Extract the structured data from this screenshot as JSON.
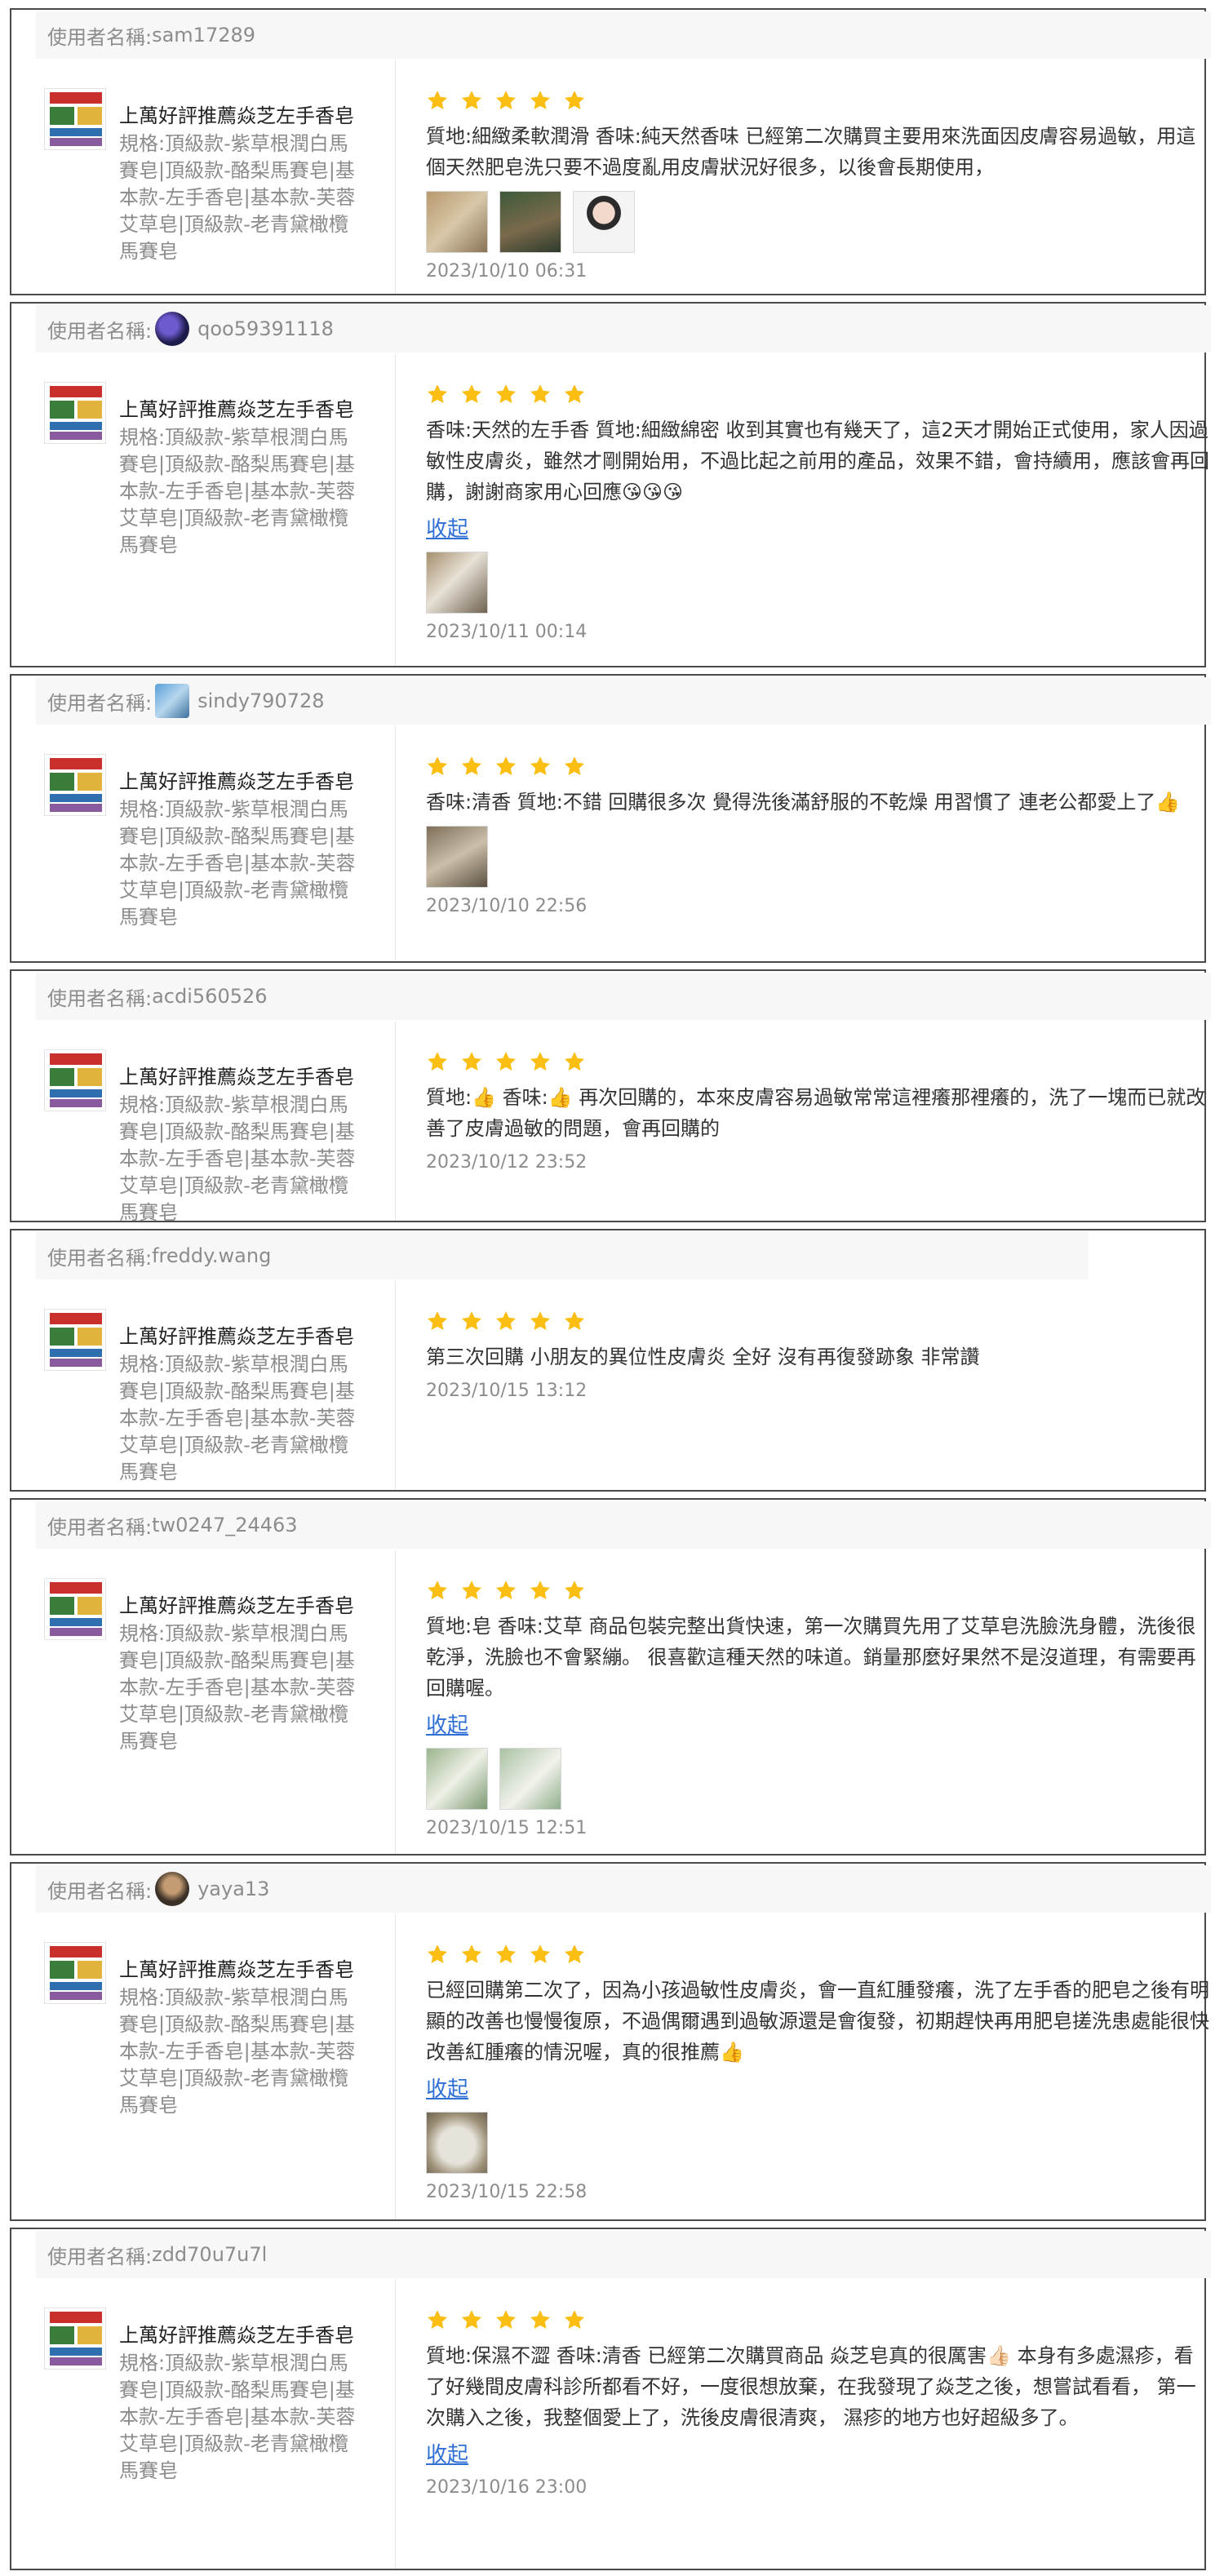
{
  "labels": {
    "username_prefix": "使用者名稱:",
    "collapse": "收起"
  },
  "product": {
    "name": "上萬好評推薦焱芝左手香皂",
    "spec": "規格:頂級款-紫草根潤白馬賽皂|頂級款-酪梨馬賽皂|基本款-左手香皂|基本款-芙蓉艾草皂|頂級款-老青黛橄欖馬賽皂"
  },
  "colors": {
    "star": "#fbbf14",
    "link": "#2f6fd6",
    "border": "#4a4a4a",
    "header_bg": "#f7f7f7"
  },
  "reviews": [
    {
      "username": "sam17289",
      "rating": 5,
      "text": "質地:細緻柔軟潤滑 香味:純天然香味 已經第二次購買主要用來洗面因皮膚容易過敏，用這個天然肥皂洗只要不過度亂用皮膚狀況好很多，以後會長期使用，",
      "photos": 3,
      "date": "2023/10/10 06:31"
    },
    {
      "username": "qoo59391118",
      "rating": 5,
      "text": "香味:天然的左手香 質地:細緻綿密 收到其實也有幾天了，這2天才開始正式使用，家人因過敏性皮膚炎，雖然才剛開始用，不過比起之前用的產品，效果不錯，會持續用，應該會再回購，謝謝商家用心回應😘😘😘",
      "photos": 1,
      "date": "2023/10/11 00:14"
    },
    {
      "username": "sindy790728",
      "rating": 5,
      "text": "香味:清香 質地:不錯 回購很多次 覺得洗後滿舒服的不乾燥 用習慣了 連老公都愛上了👍",
      "photos": 1,
      "date": "2023/10/10 22:56"
    },
    {
      "username": "acdi560526",
      "rating": 5,
      "text": "質地:👍 香味:👍 再次回購的，本來皮膚容易過敏常常這裡癢那裡癢的，洗了一塊而已就改善了皮膚過敏的問題，會再回購的",
      "photos": 0,
      "date": "2023/10/12 23:52"
    },
    {
      "username": "freddy.wang",
      "rating": 5,
      "text": "第三次回購 小朋友的異位性皮膚炎 全好 沒有再復發跡象 非常讚",
      "photos": 0,
      "date": "2023/10/15 13:12"
    },
    {
      "username": "tw0247_24463",
      "rating": 5,
      "text": "質地:皂 香味:艾草 商品包裝完整出貨快速，第一次購買先用了艾草皂洗臉洗身體，洗後很乾淨，洗臉也不會緊繃。 很喜歡這種天然的味道。銷量那麼好果然不是沒道理，有需要再回購喔。",
      "photos": 2,
      "date": "2023/10/15 12:51"
    },
    {
      "username": "yaya13",
      "rating": 5,
      "text": "已經回購第二次了，因為小孩過敏性皮膚炎，會一直紅腫發癢，洗了左手香的肥皂之後有明顯的改善也慢慢復原，不過偶爾遇到過敏源還是會復發，初期趕快再用肥皂搓洗患處能很快改善紅腫癢的情況喔，真的很推薦👍",
      "photos": 1,
      "date": "2023/10/15 22:58"
    },
    {
      "username": "zdd70u7u7l",
      "rating": 5,
      "text": "質地:保濕不澀 香味:清香 已經第二次購買商品 焱芝皂真的很厲害👍🏻 本身有多處濕疹，看了好幾間皮膚科診所都看不好，一度很想放棄，在我發現了焱芝之後，想嘗試看看， 第一次購入之後，我整個愛上了，洗後皮膚很清爽， 濕疹的地方也好超級多了。",
      "photos": 0,
      "date": "2023/10/16 23:00"
    }
  ]
}
